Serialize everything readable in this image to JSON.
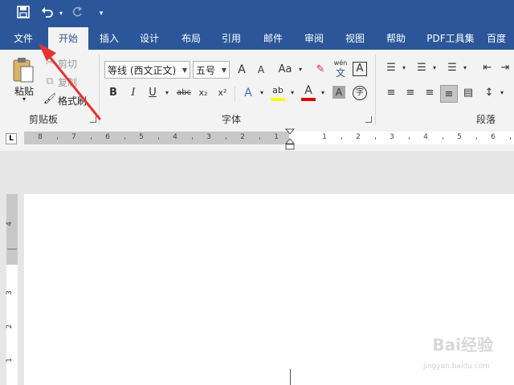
{
  "title_bar": {
    "save_icon": "save-icon",
    "undo_icon": "undo-icon",
    "redo_icon": "redo-icon",
    "customize_icon": "customize-qat-icon"
  },
  "tabs": [
    {
      "label": "文件"
    },
    {
      "label": "开始"
    },
    {
      "label": "插入"
    },
    {
      "label": "设计"
    },
    {
      "label": "布局"
    },
    {
      "label": "引用"
    },
    {
      "label": "邮件"
    },
    {
      "label": "审阅"
    },
    {
      "label": "视图"
    },
    {
      "label": "帮助"
    },
    {
      "label": "PDF工具集"
    },
    {
      "label": "百度"
    }
  ],
  "active_tab": "开始",
  "clipboard": {
    "paste_label": "粘贴",
    "cut_label": "剪切",
    "copy_label": "复制",
    "format_painter_label": "格式刷",
    "group_label": "剪贴板"
  },
  "font": {
    "font_name": "等线 (西文正文)",
    "font_size": "五号",
    "grow_label": "A",
    "shrink_label": "A",
    "case_label": "Aa",
    "phonetic_top": "wén",
    "phonetic_bottom": "文",
    "border_char_label": "A",
    "bold": "B",
    "italic": "I",
    "underline": "U",
    "strike": "abc",
    "subscript": "x₂",
    "superscript": "x²",
    "effects_label": "A",
    "highlight_label": "ab",
    "font_color_label": "A",
    "shading_label": "A",
    "enclose_label": "字",
    "group_label": "字体"
  },
  "paragraph": {
    "group_label": "段落"
  },
  "ruler": {
    "left_numbers": [
      "8",
      "7",
      "6",
      "5",
      "4",
      "3",
      "2",
      "1"
    ],
    "right_numbers": [
      "1",
      "2",
      "3",
      "4",
      "5",
      "6"
    ],
    "tab_selector": "L"
  },
  "vertical_ruler": {
    "numbers": [
      "4",
      "3",
      "2",
      "1"
    ]
  },
  "colors": {
    "brand_blue": "#2b579a",
    "annotation_arrow": "#e8322f",
    "highlight_yellow": "#ffff00",
    "font_red": "#e00000"
  },
  "watermark": {
    "text": "Bai经验",
    "url": "jingyan.baidu.com"
  }
}
